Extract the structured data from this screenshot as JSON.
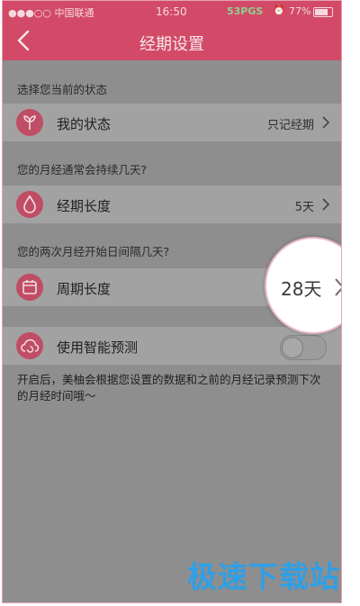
{
  "status_bar": {
    "carrier": "●●●○○ 中国联通",
    "time": "16:50",
    "network": "53PGS",
    "battery": "77%",
    "battery_level": 0.77
  },
  "nav": {
    "title": "经期设置"
  },
  "sections": {
    "state_label": "选择您当前的状态",
    "period_label": "您的月经通常会持续几天?",
    "cycle_label": "您的两次月经开始日间隔几天?"
  },
  "rows": {
    "my_state": {
      "label": "我的状态",
      "value": "只记经期"
    },
    "period_length": {
      "label": "经期长度",
      "value": "5天"
    },
    "cycle_length": {
      "label": "周期长度",
      "value": "28天"
    },
    "smart_predict": {
      "label": "使用智能预测",
      "enabled": false
    }
  },
  "note": "开启后，美柚会根据您设置的数据和之前的月经记录预测下次的月经时间哦～",
  "watermark": "极速下载站",
  "colors": {
    "accent": "#d24a68",
    "icon_bg": "#c04d66",
    "watermark": "#2f9fe6"
  }
}
